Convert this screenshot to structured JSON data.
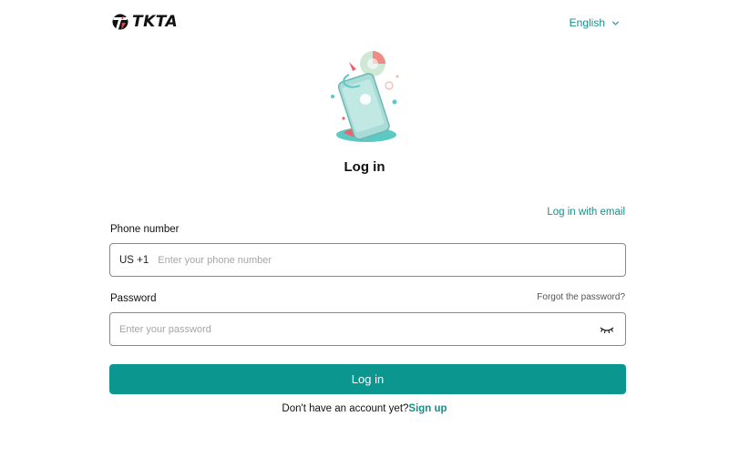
{
  "brand": {
    "name": "TKTA",
    "accent_color": "#0b9690"
  },
  "header": {
    "language": "English"
  },
  "login": {
    "title": "Log in",
    "email_link": "Log in with email",
    "phone_label": "Phone number",
    "country_code": "US +1",
    "phone_placeholder": "Enter your phone number",
    "password_label": "Password",
    "forgot_link": "Forgot the password?",
    "password_placeholder": "Enter your password",
    "submit_label": "Log in",
    "signup_prompt": "Don't have an account yet?",
    "signup_link": "Sign up"
  },
  "icons": {
    "language_toggle": "chevron-down-icon",
    "password_visibility": "eye-closed-icon"
  }
}
